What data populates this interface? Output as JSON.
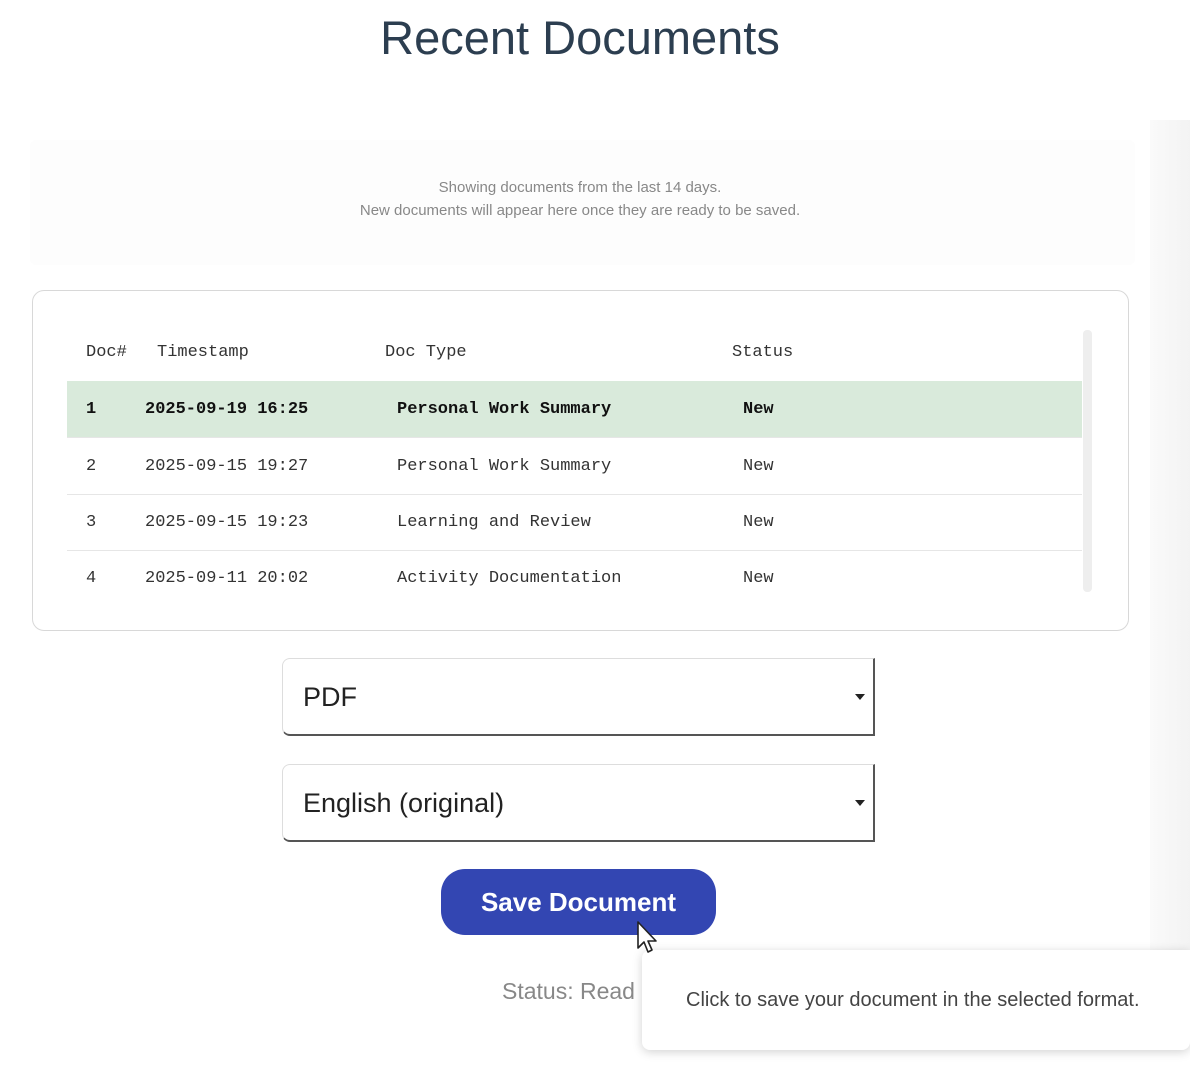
{
  "header": {
    "title": "Recent Documents"
  },
  "notice": {
    "line1": "Showing documents from the last 14 days.",
    "line2": "New documents will appear here once they are ready to be saved."
  },
  "table": {
    "columns": [
      "Doc#",
      "Timestamp",
      "Doc Type",
      "Status"
    ],
    "rows": [
      {
        "num": "1",
        "timestamp": "2025-09-19 16:25",
        "type": "Personal Work Summary",
        "status": "New"
      },
      {
        "num": "2",
        "timestamp": "2025-09-15 19:27",
        "type": "Personal Work Summary",
        "status": "New"
      },
      {
        "num": "3",
        "timestamp": "2025-09-15 19:23",
        "type": "Learning and Review",
        "status": "New"
      },
      {
        "num": "4",
        "timestamp": "2025-09-11 20:02",
        "type": "Activity Documentation",
        "status": "New"
      }
    ],
    "selected_row": 0
  },
  "format_select": {
    "value": "PDF"
  },
  "language_select": {
    "value": "English (original)"
  },
  "save": {
    "label": "Save Document"
  },
  "status": {
    "text": "Status: Read"
  },
  "tooltip": {
    "text": "Click to save your document in the selected format."
  },
  "colors": {
    "accent": "#3346b2",
    "selected_row": "#d9eadb",
    "title": "#2c3e50"
  },
  "icons": {
    "select_caret": "caret-down-icon",
    "cursor": "mouse-pointer-icon"
  }
}
